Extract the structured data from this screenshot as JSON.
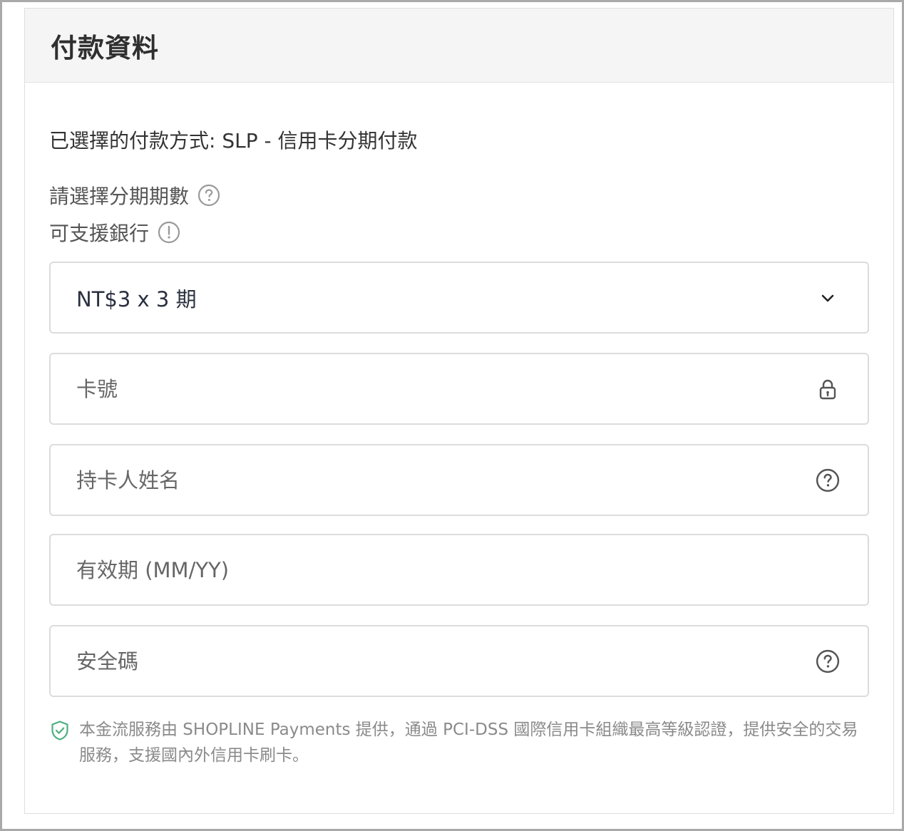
{
  "header": {
    "title": "付款資料"
  },
  "payment": {
    "selected_method": "已選擇的付款方式: SLP - 信用卡分期付款",
    "installment_label": "請選擇分期期數",
    "banks_label": "可支援銀行",
    "installment_select": {
      "selected_value": "NT$3 x 3 期"
    },
    "fields": {
      "card_number_placeholder": "卡號",
      "cardholder_name_placeholder": "持卡人姓名",
      "expiry_placeholder": "有效期 (MM/YY)",
      "security_code_placeholder": "安全碼"
    },
    "notice": "本金流服務由 SHOPLINE Payments 提供，通過 PCI-DSS 國際信用卡組織最高等級認證，提供安全的交易服務，支援國內外信用卡刷卡。"
  },
  "icons": {
    "installment_help": "question-circle-icon",
    "banks_info": "exclamation-circle-icon",
    "select_chevron": "chevron-down-icon",
    "card_lock": "lock-icon",
    "cardholder_help": "question-circle-icon",
    "security_help": "question-circle-icon",
    "notice_shield": "shield-check-icon"
  },
  "colors": {
    "shield_accent": "#4caf7d",
    "header_bg": "#f5f5f5",
    "field_border": "#dcdcdc"
  }
}
